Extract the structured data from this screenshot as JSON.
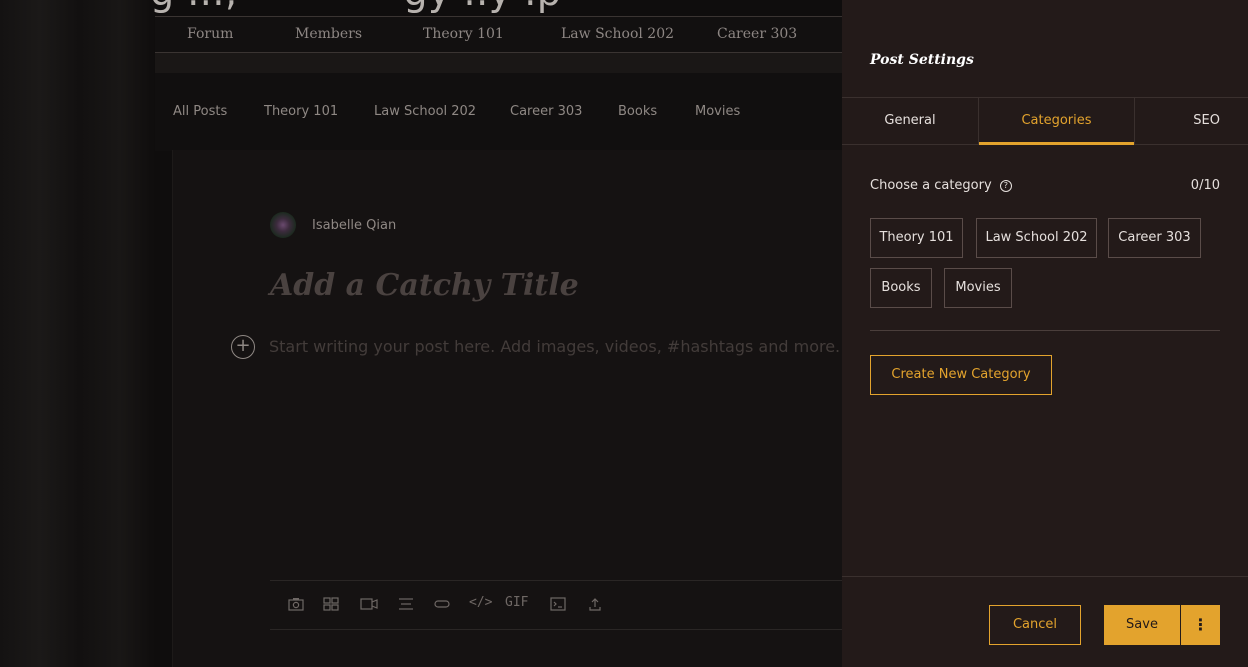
{
  "background": {
    "headline": "g ..., — — — gy ..y .p"
  },
  "site_nav": {
    "items": [
      "Forum",
      "Members",
      "Theory 101",
      "Law School 202",
      "Career 303"
    ]
  },
  "category_tabs": {
    "items": [
      "All Posts",
      "Theory 101",
      "Law School 202",
      "Career 303",
      "Books",
      "Movies"
    ]
  },
  "editor": {
    "author": "Isabelle Qian",
    "title_placeholder": "Add a Catchy Title",
    "body_placeholder": "Start writing your post here. Add images, videos, #hashtags and more.",
    "add_icon": "plus-circle-icon",
    "toolbar": {
      "icons": [
        "camera-icon",
        "gallery-icon",
        "video-icon",
        "divider-icon",
        "button-icon",
        "code-icon",
        "gif-icon",
        "code-block-icon",
        "upload-icon"
      ],
      "code_label": "</>",
      "gif_label": "GIF"
    }
  },
  "panel": {
    "title": "Post Settings",
    "tabs": [
      "General",
      "Categories",
      "SEO"
    ],
    "active_tab": "Categories",
    "choose_label": "Choose a category",
    "help_icon": "question-circle-icon",
    "counter": "0/10",
    "categories": [
      "Theory 101",
      "Law School 202",
      "Career 303",
      "Books",
      "Movies"
    ],
    "create_label": "Create New Category",
    "cancel_label": "Cancel",
    "save_label": "Save",
    "more_icon": "vertical-dots-icon"
  },
  "colors": {
    "accent": "#e3a32d",
    "panel_bg": "#231a19",
    "editor_bg": "#151212"
  }
}
